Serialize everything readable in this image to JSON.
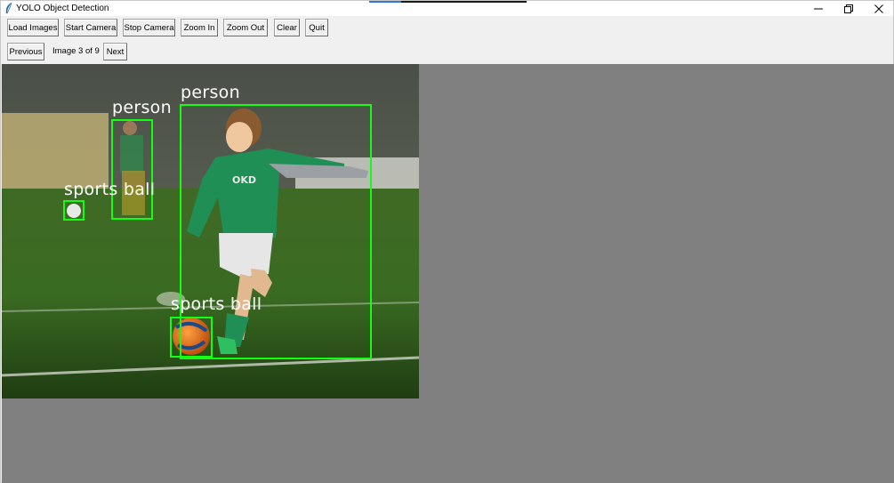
{
  "window": {
    "title": "YOLO Object Detection",
    "controls": {
      "minimize": "minimize-icon",
      "restore": "restore-icon",
      "close": "close-icon"
    }
  },
  "toolbar": {
    "load_images": "Load Images",
    "start_camera": "Start Camera",
    "stop_camera": "Stop Camera",
    "zoom_in": "Zoom In",
    "zoom_out": "Zoom Out",
    "clear": "Clear",
    "quit": "Quit"
  },
  "navigation": {
    "previous": "Previous",
    "status": "Image 3 of 9",
    "next": "Next"
  },
  "detections": [
    {
      "label": "person"
    },
    {
      "label": "person"
    },
    {
      "label": "sports ball"
    },
    {
      "label": "sports ball"
    }
  ],
  "colors": {
    "box": "#12ff12",
    "label_text": "#ffffff",
    "canvas_bg": "#808080"
  }
}
